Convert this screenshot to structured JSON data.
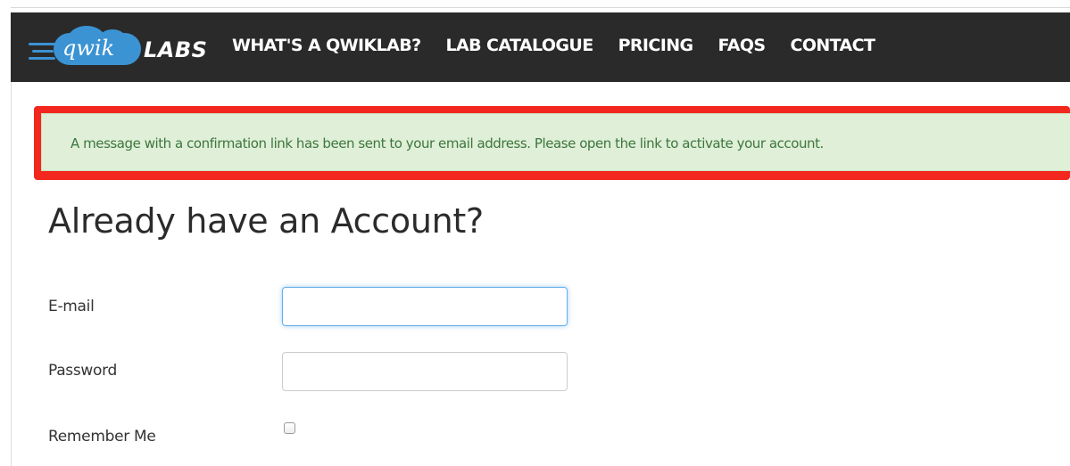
{
  "brand": {
    "logo_word_1": "qwik",
    "logo_word_2": "LABS",
    "logo_color": "#3b93d3"
  },
  "nav": {
    "items": [
      {
        "label": "WHAT'S A QWIKLAB?"
      },
      {
        "label": "LAB CATALOGUE"
      },
      {
        "label": "PRICING"
      },
      {
        "label": "FAQS"
      },
      {
        "label": "CONTACT"
      }
    ],
    "background": "#2a2a2a"
  },
  "alert": {
    "message": "A message with a confirmation link has been sent to your email address. Please open the link to activate your account.",
    "type": "success",
    "highlight_color": "#f2271e"
  },
  "login": {
    "heading": "Already have an Account?",
    "email_label": "E-mail",
    "email_value": "",
    "email_focused": true,
    "password_label": "Password",
    "password_value": "",
    "remember_label": "Remember Me",
    "remember_checked": false
  }
}
